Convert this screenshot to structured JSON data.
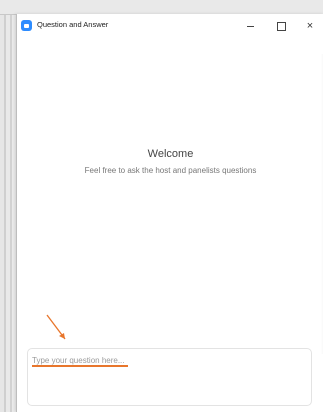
{
  "window": {
    "title": "Question and Answer",
    "controls": {
      "minimize": "–",
      "maximize": "□",
      "close": "×"
    }
  },
  "main": {
    "welcome_heading": "Welcome",
    "welcome_subtitle": "Feel free to ask the host and panelists questions"
  },
  "question_input": {
    "placeholder": "Type your question here...",
    "value": ""
  },
  "annotation": {
    "arrow_color": "#e8762c",
    "underline_color": "#e8762c"
  },
  "icons": {
    "app": "zoom-app-icon",
    "arrow": "annotation-arrow-icon"
  },
  "colors": {
    "accent": "#2d8cff"
  }
}
